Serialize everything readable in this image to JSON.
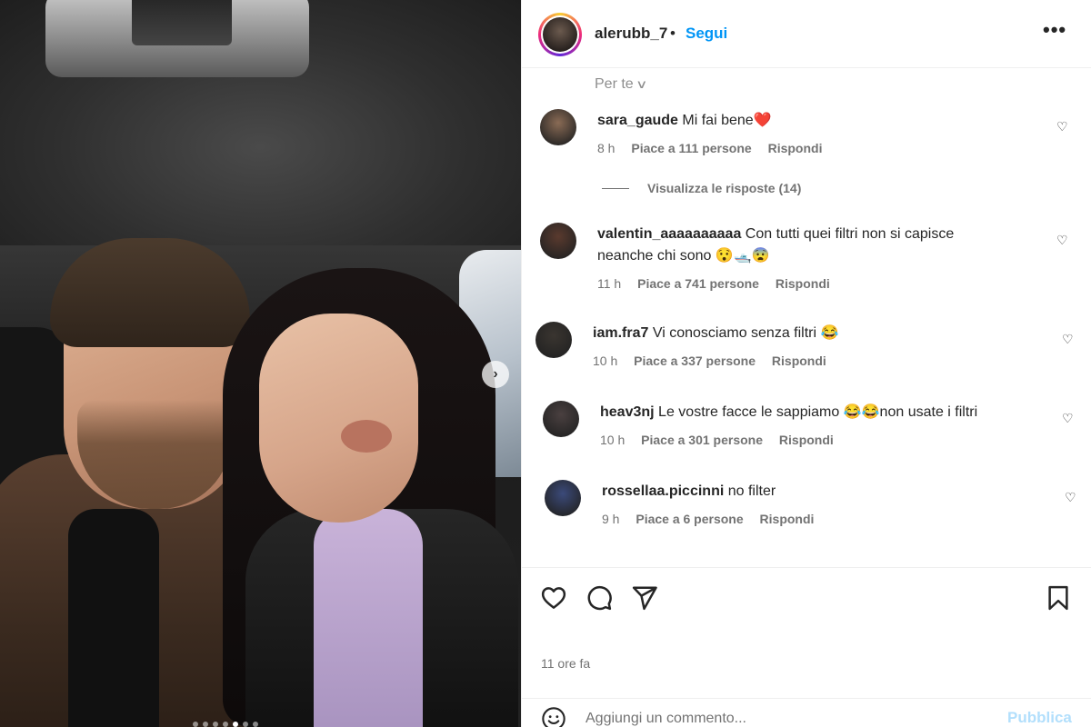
{
  "post": {
    "author": "alerubb_7",
    "separator": "•",
    "follow_label": "Segui",
    "more_icon": "more-horizontal-icon",
    "more_label": "•••"
  },
  "comments_filter": {
    "label": "Per te",
    "icon": "chevron-down-icon"
  },
  "comments": [
    {
      "username": "sara_gaude",
      "text": "Mi fai bene❤️",
      "time": "8 h",
      "likes": "Piace a 111 persone",
      "reply": "Rispondi",
      "avatar_color": "#8a6b55"
    },
    {
      "username": "valentin_aaaaaaaaaa",
      "text": "Con tutti quei filtri non si capisce",
      "text2": "neanche chi sono 😯🛥️😨",
      "time": "11 h",
      "likes": "Piace a 741 persone",
      "reply": "Rispondi",
      "avatar_color": "#5a3a2e"
    },
    {
      "username": "iam.fra7",
      "text": "Vi conosciamo senza filtri 😂",
      "time": "10 h",
      "likes": "Piace a 337 persone",
      "reply": "Rispondi",
      "avatar_color": "#3a3530"
    },
    {
      "username": "heav3nj",
      "text": "Le vostre facce le sappiamo 😂😂non usate i filtri",
      "time": "10 h",
      "likes": "Piace a 301 persone",
      "reply": "Rispondi",
      "avatar_color": "#4a4040"
    },
    {
      "username": "rossellaa.piccinni",
      "text": "no filter",
      "time": "9 h",
      "likes": "Piace a 6 persone",
      "reply": "Rispondi",
      "avatar_color": "#3b4a7a"
    }
  ],
  "replies_toggle": "Visualizza le risposte (14)",
  "heart_glyph": "♡",
  "carousel_next": "›",
  "actions": {
    "like_icon": "heart-icon",
    "comment_icon": "comment-icon",
    "share_icon": "share-icon",
    "save_icon": "bookmark-icon"
  },
  "post_time": "11 ore fa",
  "add_comment": {
    "placeholder": "Aggiungi un commento...",
    "publish_label": "Pubblica",
    "emoji_icon": "emoji-icon"
  },
  "colors": {
    "link_blue": "#0095f6",
    "publish_disabled": "#b2dffc",
    "meta_gray": "#737373"
  }
}
